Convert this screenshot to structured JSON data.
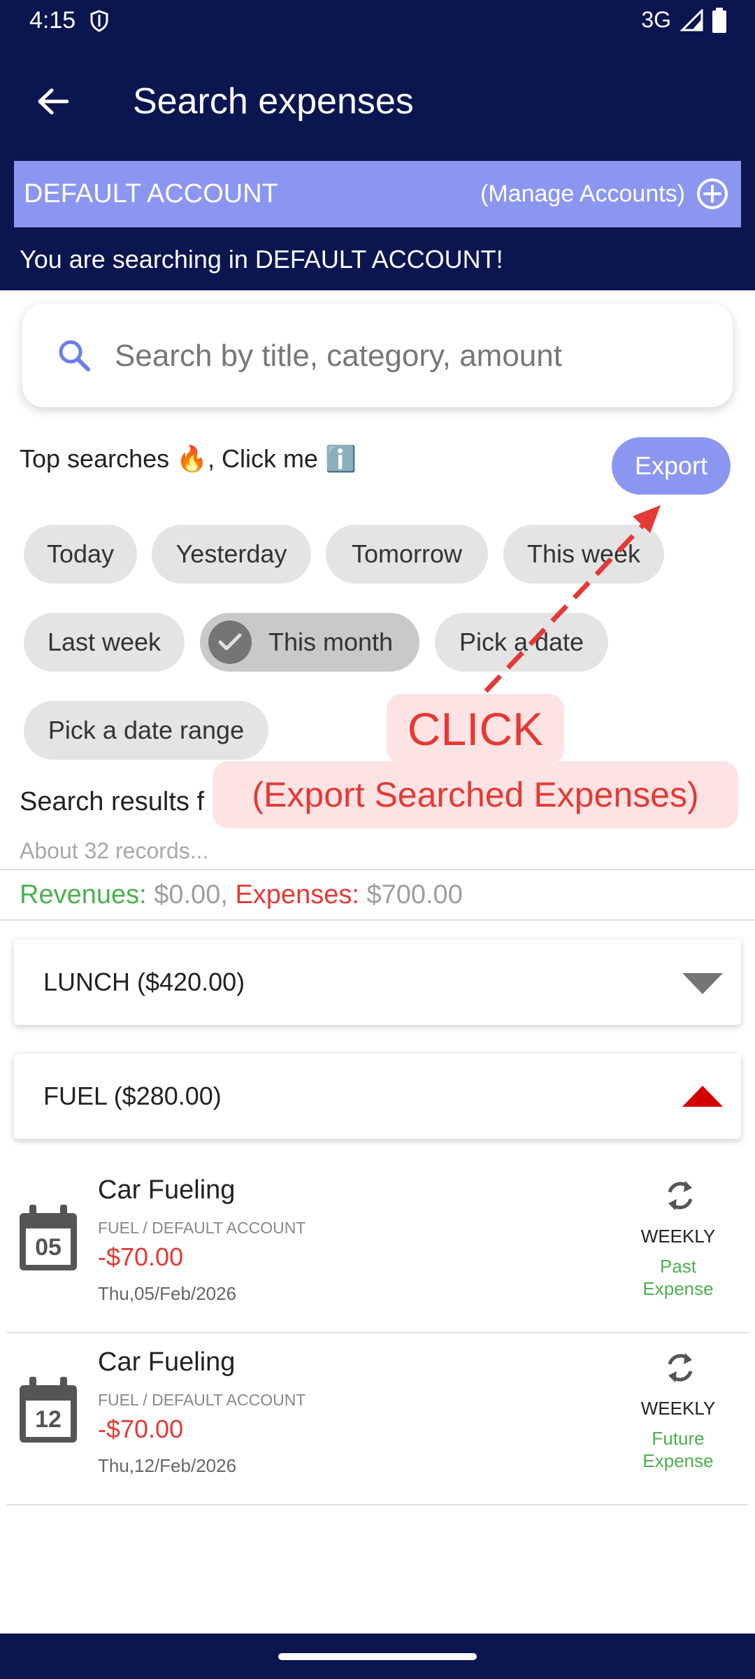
{
  "status_bar": {
    "time": "4:15",
    "network": "3G"
  },
  "header": {
    "title": "Search expenses"
  },
  "account": {
    "name": "DEFAULT ACCOUNT",
    "manage_label": "(Manage Accounts)",
    "searching_text": "You are searching in DEFAULT ACCOUNT!"
  },
  "search": {
    "placeholder": "Search by title, category, amount"
  },
  "top_searches": {
    "label": "Top searches 🔥, Click me ℹ️",
    "export_label": "Export"
  },
  "chips": {
    "today": "Today",
    "yesterday": "Yesterday",
    "tomorrow": "Tomorrow",
    "this_week": "This week",
    "last_week": "Last week",
    "this_month": "This month",
    "pick_date": "Pick a date",
    "pick_date_range": "Pick a date range"
  },
  "selected_chip": "This month",
  "results": {
    "title": "Search results f",
    "records": "About 32 records...",
    "revenues_label": "Revenues:",
    "revenues_value": "$0.00,",
    "expenses_label": "Expenses:",
    "expenses_value": "$700.00"
  },
  "groups": [
    {
      "label": "LUNCH ($420.00)",
      "expanded": false,
      "arrow_color": "#757575"
    },
    {
      "label": "FUEL ($280.00)",
      "expanded": true,
      "arrow_color": "#d50000"
    }
  ],
  "expenses": [
    {
      "day": "05",
      "title": "Car Fueling",
      "category": "FUEL / DEFAULT ACCOUNT",
      "amount": "-$70.00",
      "date": "Thu,05/Feb/2026",
      "frequency": "WEEKLY",
      "status_line1": "Past",
      "status_line2": "Expense"
    },
    {
      "day": "12",
      "title": "Car Fueling",
      "category": "FUEL / DEFAULT ACCOUNT",
      "amount": "-$70.00",
      "date": "Thu,12/Feb/2026",
      "frequency": "WEEKLY",
      "status_line1": "Future",
      "status_line2": "Expense"
    }
  ],
  "callout": {
    "click": "CLICK",
    "subtitle": "(Export Searched Expenses)"
  },
  "colors": {
    "primary": "#0b1550",
    "accent": "#8b96f0",
    "revenue": "#4caf50",
    "expense": "#e53935",
    "callout_bg": "#fde3e3"
  }
}
